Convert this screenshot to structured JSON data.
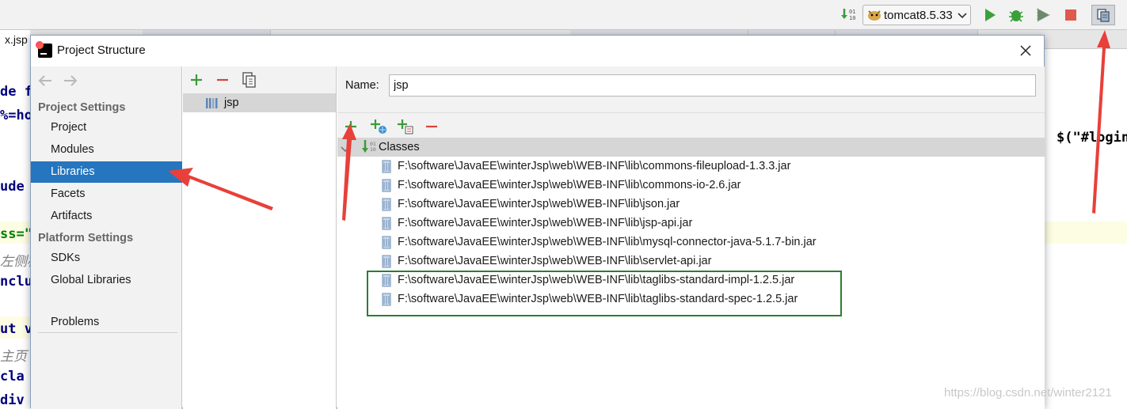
{
  "ide": {
    "editor_tab_label": "x.jsp",
    "run_config": {
      "label": "tomcat8.5.33"
    },
    "code_left": [
      "de f",
      "%=ho",
      "ude",
      "ss=\"",
      "左侧栏",
      "nclu",
      "ut v",
      "主页",
      "cla",
      "div"
    ],
    "code_right": "$(\"#login",
    "watermark": "https://blog.csdn.net/winter2121"
  },
  "dialog": {
    "title": "Project Structure",
    "sidebar": {
      "project_settings_header": "Project Settings",
      "platform_settings_header": "Platform Settings",
      "items_project": [
        {
          "label": "Project",
          "selected": false
        },
        {
          "label": "Modules",
          "selected": false
        },
        {
          "label": "Libraries",
          "selected": true
        },
        {
          "label": "Facets",
          "selected": false
        },
        {
          "label": "Artifacts",
          "selected": false
        }
      ],
      "items_platform": [
        {
          "label": "SDKs"
        },
        {
          "label": "Global Libraries"
        }
      ],
      "problems_label": "Problems"
    },
    "libraries": {
      "selected_library": "jsp"
    },
    "details": {
      "name_label": "Name:",
      "name_value": "jsp",
      "classes_label": "Classes",
      "jars": [
        "F:\\software\\JavaEE\\winterJsp\\web\\WEB-INF\\lib\\commons-fileupload-1.3.3.jar",
        "F:\\software\\JavaEE\\winterJsp\\web\\WEB-INF\\lib\\commons-io-2.6.jar",
        "F:\\software\\JavaEE\\winterJsp\\web\\WEB-INF\\lib\\json.jar",
        "F:\\software\\JavaEE\\winterJsp\\web\\WEB-INF\\lib\\jsp-api.jar",
        "F:\\software\\JavaEE\\winterJsp\\web\\WEB-INF\\lib\\mysql-connector-java-5.1.7-bin.jar",
        "F:\\software\\JavaEE\\winterJsp\\web\\WEB-INF\\lib\\servlet-api.jar",
        "F:\\software\\JavaEE\\winterJsp\\web\\WEB-INF\\lib\\taglibs-standard-impl-1.2.5.jar",
        "F:\\software\\JavaEE\\winterJsp\\web\\WEB-INF\\lib\\taglibs-standard-spec-1.2.5.jar"
      ]
    }
  },
  "colors": {
    "selection": "#2675bf",
    "annotation_arrow": "#e8403a",
    "highlight_box": "#2e7d32",
    "add_icon": "#3c9b3c",
    "remove_icon": "#d9433a"
  }
}
